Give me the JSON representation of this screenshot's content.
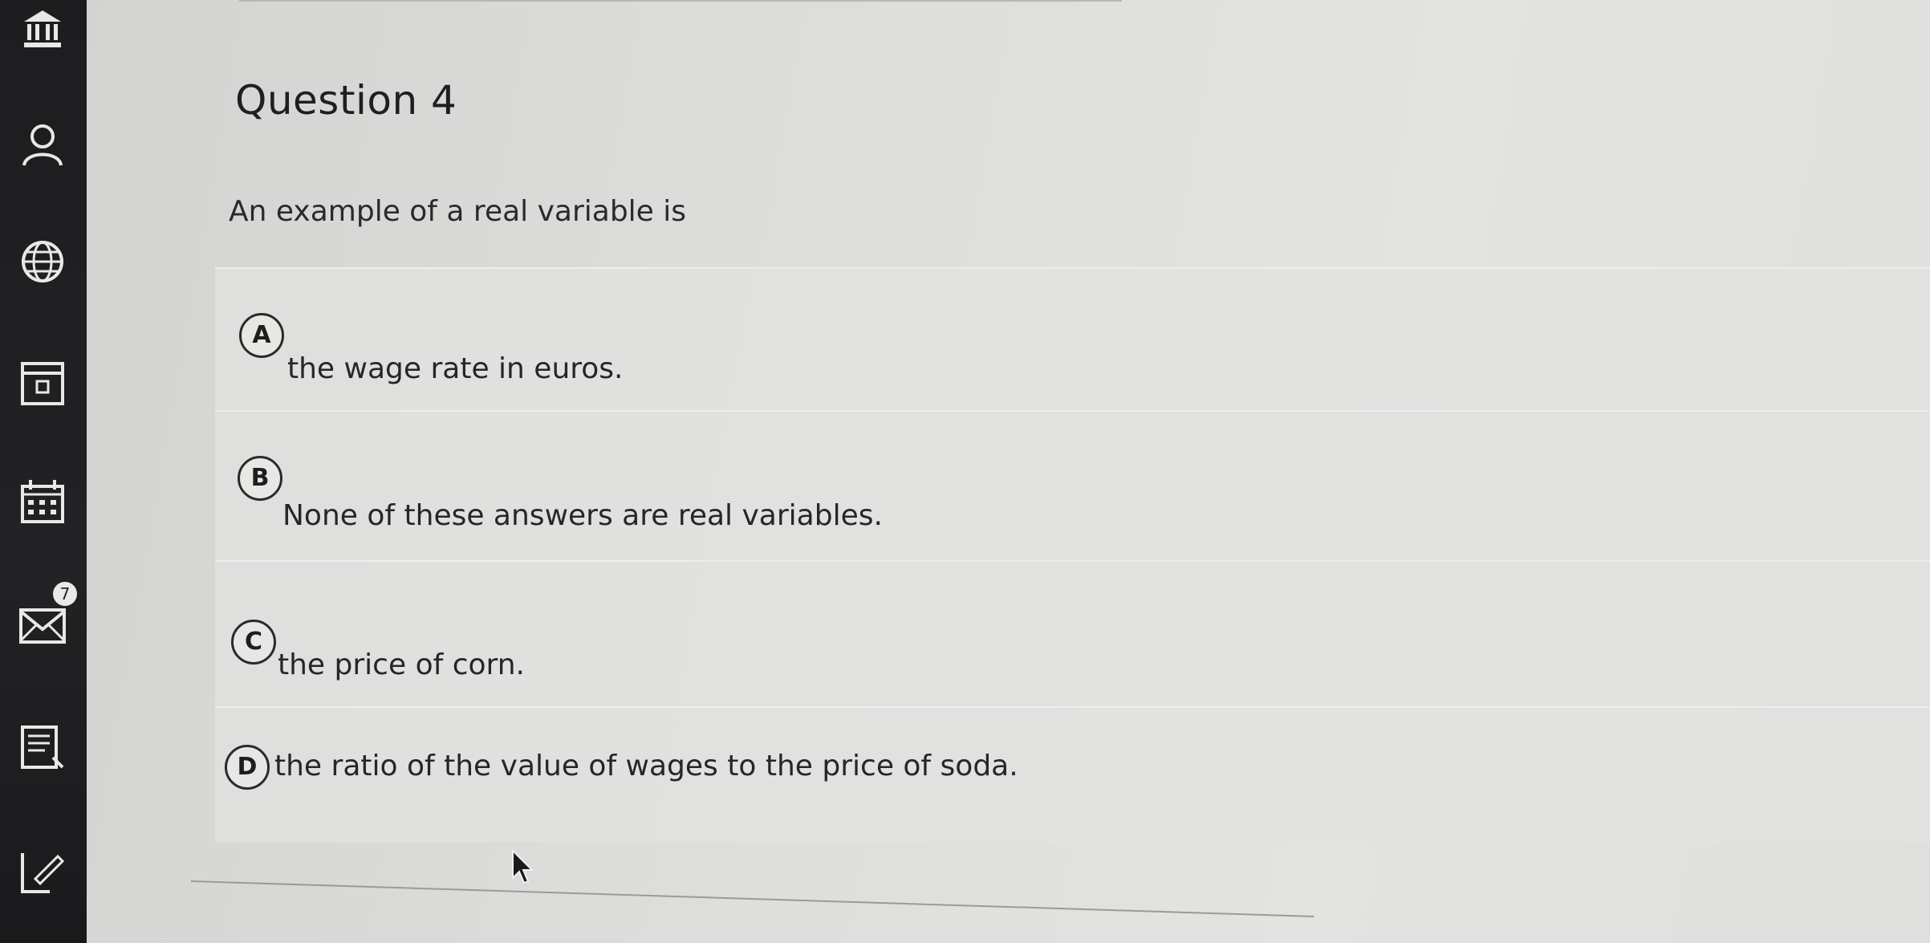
{
  "sidebar": {
    "icons": [
      {
        "name": "institution-icon"
      },
      {
        "name": "account-icon"
      },
      {
        "name": "globe-icon"
      },
      {
        "name": "dashboard-icon"
      },
      {
        "name": "calendar-icon"
      },
      {
        "name": "inbox-icon",
        "badge": "7"
      },
      {
        "name": "history-icon"
      },
      {
        "name": "help-icon"
      }
    ]
  },
  "question": {
    "title": "Question 4",
    "prompt": "An example of a real variable is",
    "choices": [
      {
        "letter": "A",
        "text": "the wage rate in euros."
      },
      {
        "letter": "B",
        "text": "None of these answers are real variables."
      },
      {
        "letter": "C",
        "text": "the price of corn."
      },
      {
        "letter": "D",
        "text": "the ratio of the value of wages to the price of soda."
      }
    ]
  },
  "colors": {
    "sidebar_bg": "#1d1d1f",
    "page_bg": "#dcdcda",
    "choice_bg": "#e2e2e0",
    "text": "#2a2a2a"
  }
}
